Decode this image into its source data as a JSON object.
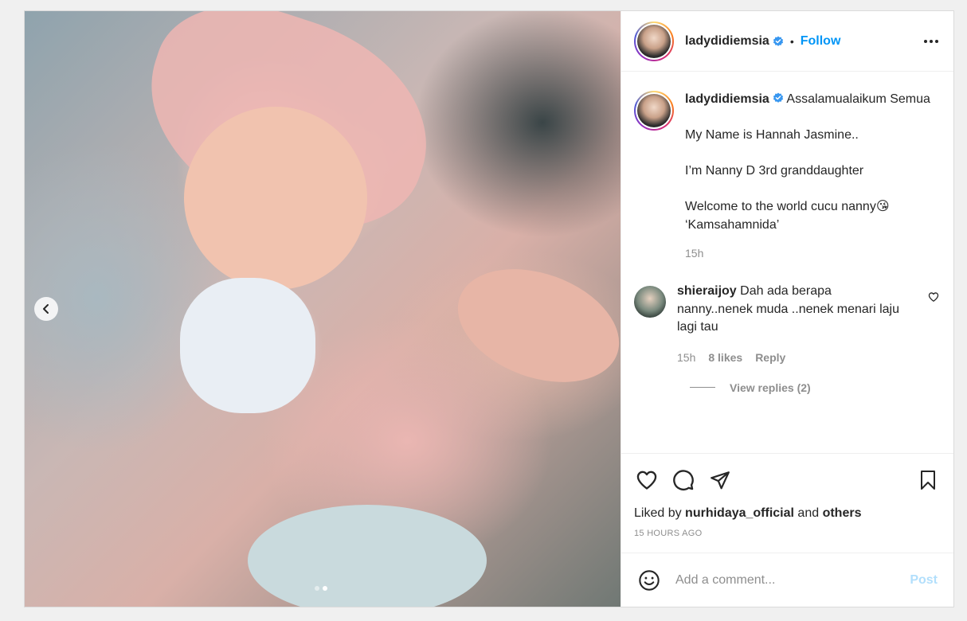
{
  "post": {
    "username": "ladydidiemsia",
    "follow_label": "Follow",
    "separator": "•"
  },
  "caption": {
    "username": "ladydidiemsia",
    "first_line": "Assalamualaikum Semua",
    "lines": [
      "My Name is Hannah Jasmine..",
      "I’m Nanny D 3rd granddaughter",
      "Welcome to the world cucu nanny😘 ‘Kamsahamnida’"
    ],
    "time": "15h"
  },
  "comment": {
    "username": "shieraijoy",
    "text": "Dah ada berapa nanny..nenek muda ..nenek menari laju lagi tau",
    "time": "15h",
    "likes": "8 likes",
    "reply_label": "Reply",
    "view_replies": "View replies (2)"
  },
  "likes": {
    "prefix": "Liked by",
    "user": "nurhidaya_official",
    "and": "and",
    "others": "others"
  },
  "timestamp": "15 HOURS AGO",
  "add_comment": {
    "placeholder": "Add a comment...",
    "post_label": "Post"
  },
  "carousel": {
    "current": 2,
    "total": 2
  },
  "colors": {
    "accent": "#0095f6",
    "verified": "#3897f0",
    "muted": "#8e8e8e",
    "post_disabled": "#b2dffc"
  },
  "icons": [
    "chevron-left-icon",
    "verified-icon",
    "more-icon",
    "heart-icon",
    "comment-icon",
    "share-icon",
    "bookmark-icon",
    "emoji-icon"
  ]
}
